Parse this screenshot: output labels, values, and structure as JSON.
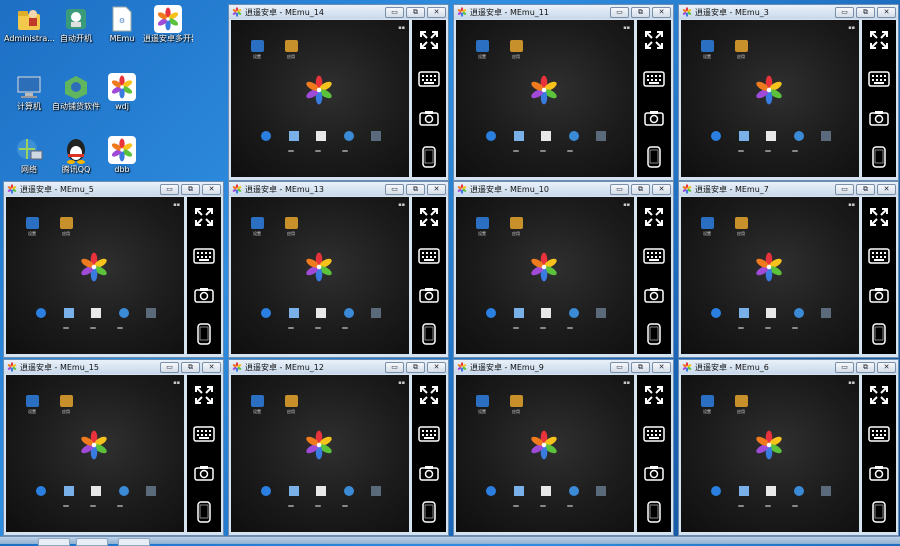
{
  "desktop": {
    "icons": [
      {
        "label": "Administra...",
        "icon": "user-folder-icon",
        "col": 0,
        "row": 0
      },
      {
        "label": "自动开机",
        "icon": "shortcut-app-icon",
        "col": 1,
        "row": 0
      },
      {
        "label": "MEmu",
        "icon": "file-document-icon",
        "col": 2,
        "row": 0
      },
      {
        "label": "逍遥安卓多开器管理",
        "icon": "memu-pinwheel-icon",
        "col": 3,
        "row": 0
      },
      {
        "label": "计算机",
        "icon": "computer-icon",
        "col": 0,
        "row": 1
      },
      {
        "label": "自动铺货软件",
        "icon": "network-app-icon",
        "col": 1,
        "row": 1
      },
      {
        "label": "wdj",
        "icon": "memu-pinwheel-icon",
        "col": 2,
        "row": 1
      },
      {
        "label": "网络",
        "icon": "network-globe-icon",
        "col": 0,
        "row": 2
      },
      {
        "label": "腾讯QQ",
        "icon": "qq-penguin-icon",
        "col": 1,
        "row": 2
      },
      {
        "label": "dbb",
        "icon": "memu-pinwheel-icon",
        "col": 2,
        "row": 2
      }
    ]
  },
  "emulators": [
    {
      "title": "逍遥安卓 - MEmu_14"
    },
    {
      "title": "逍遥安卓 - MEmu_11"
    },
    {
      "title": "逍遥安卓 - MEmu_3"
    },
    {
      "title": "逍遥安卓 - MEmu_5"
    },
    {
      "title": "逍遥安卓 - MEmu_13"
    },
    {
      "title": "逍遥安卓 - MEmu_10"
    },
    {
      "title": "逍遥安卓 - MEmu_7"
    },
    {
      "title": "逍遥安卓 - MEmu_15"
    },
    {
      "title": "逍遥安卓 - MEmu_12"
    },
    {
      "title": "逍遥安卓 - MEmu_9"
    },
    {
      "title": "逍遥安卓 - MEmu_6"
    }
  ],
  "window_controls": {
    "minimize": "▭",
    "restore": "⧉",
    "close": "✕"
  },
  "screen": {
    "app1_label": "设置",
    "app2_label": "应用"
  },
  "colors": {
    "memu_red": "#e8323c",
    "memu_yellow": "#f6c21b",
    "memu_green": "#5cc23c",
    "memu_blue": "#3a7be0",
    "memu_purple": "#a04ad8"
  }
}
